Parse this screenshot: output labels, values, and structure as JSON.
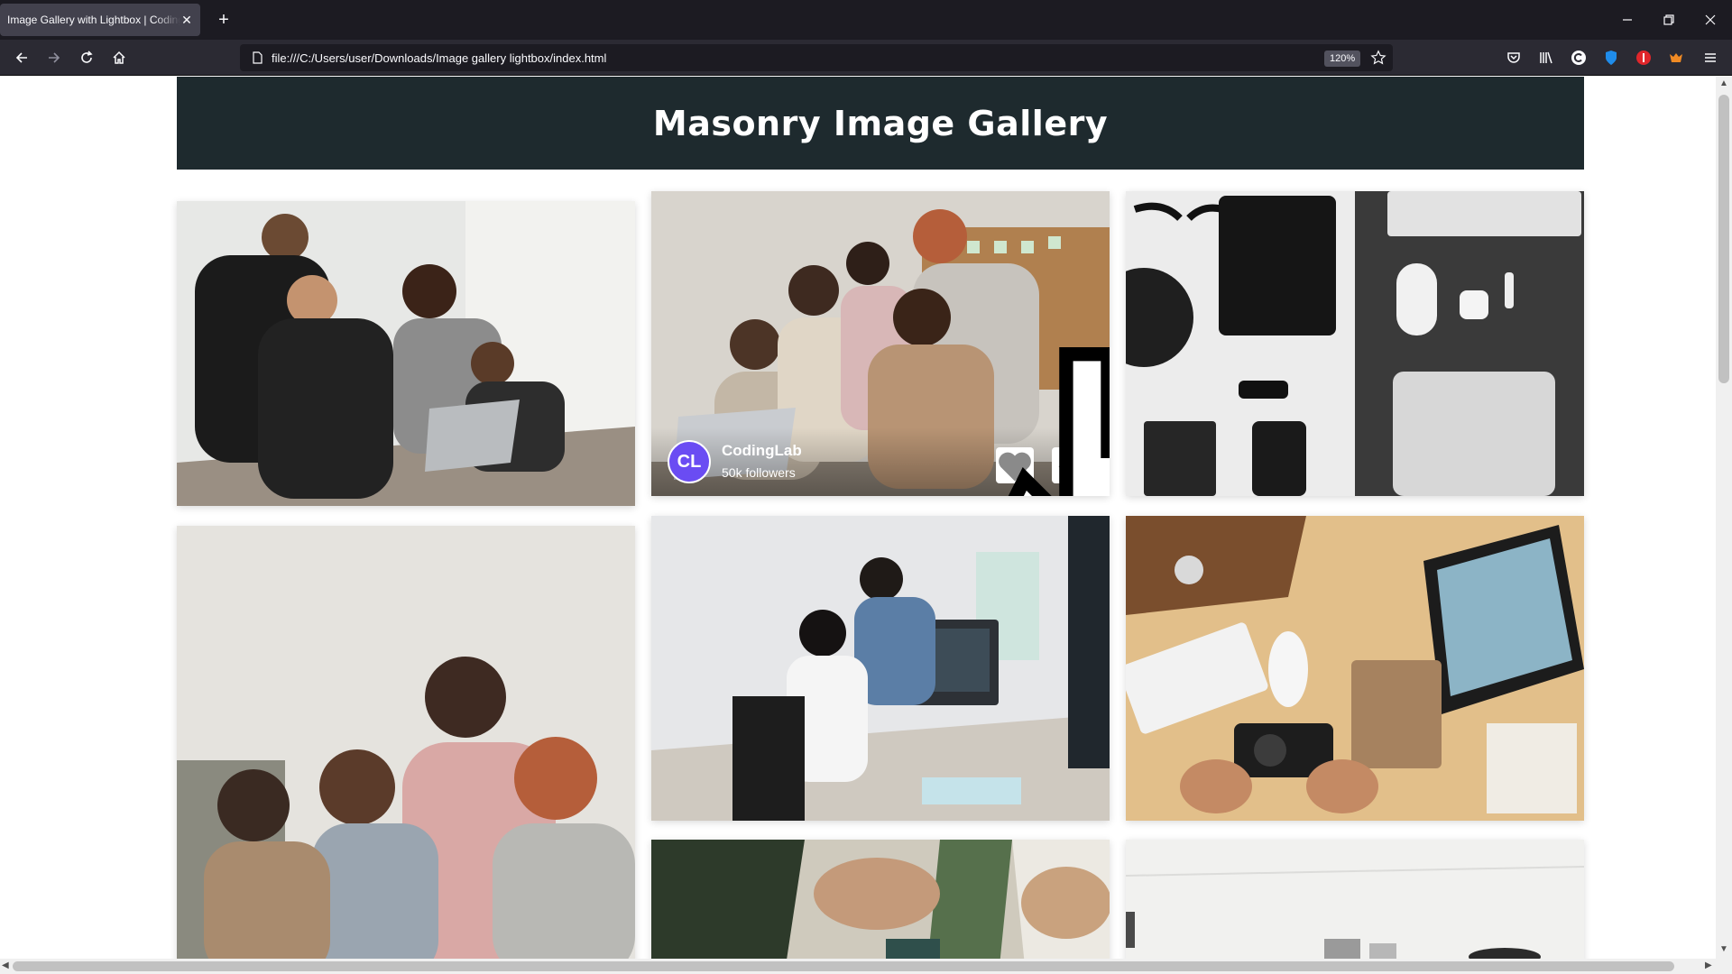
{
  "browser": {
    "tab_title": "Image Gallery with Lightbox | CodingLab",
    "tab_close": "✕",
    "new_tab": "+",
    "url": "file:///C:/Users/user/Downloads/Image gallery lightbox/index.html",
    "zoom": "120%"
  },
  "page": {
    "title": "Masonry Image Gallery"
  },
  "featured_card": {
    "avatar_initials": "CL",
    "author_name": "CodingLab",
    "author_followers": "50k followers"
  },
  "gallery": [
    {
      "subject": "team-around-laptop"
    },
    {
      "subject": "coworkers-smiling-at-laptop"
    },
    {
      "subject": "flat-lay-tech-devices"
    },
    {
      "subject": "group-meeting-at-table"
    },
    {
      "subject": "developers-at-monitor"
    },
    {
      "subject": "desk-top-view-with-camera"
    },
    {
      "subject": "hands-at-desk"
    },
    {
      "subject": "bright-office-interior"
    }
  ],
  "colors": {
    "header_bg": "#1e2a2e",
    "avatar_bg": "#6a4cf3",
    "chrome_bg": "#1c1b22"
  }
}
